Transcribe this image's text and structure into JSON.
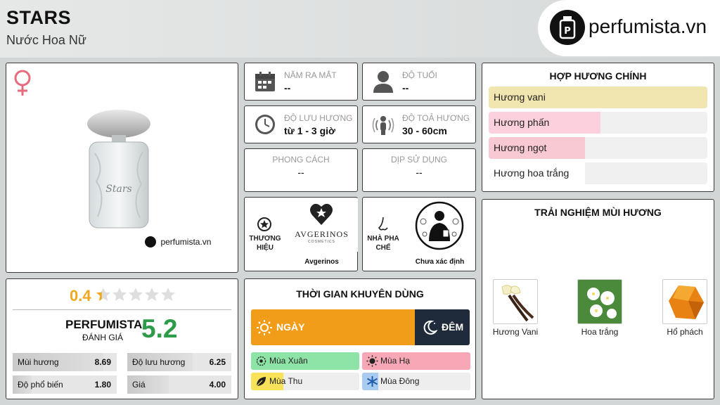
{
  "header": {
    "title": "STARS",
    "subtitle": "Nước Hoa Nữ",
    "logo_text": "perfumista.vn"
  },
  "product": {
    "watermark": "perfumista.vn",
    "bottle_script": "Stars"
  },
  "stats": {
    "release": {
      "label": "NĂM RA MẮT",
      "value": "--"
    },
    "age": {
      "label": "ĐỘ TUỔI",
      "value": "--"
    },
    "longevity": {
      "label": "ĐỘ LƯU HƯƠNG",
      "value": "từ 1 - 3 giờ"
    },
    "sillage": {
      "label": "ĐỘ TOẢ HƯƠNG",
      "value": "30 - 60cm"
    },
    "style": {
      "label": "PHONG CÁCH",
      "value": "--"
    },
    "occasion": {
      "label": "DỊP SỬ DỤNG",
      "value": "--"
    }
  },
  "brand": {
    "label": "THƯƠNG HIỆU",
    "logo_name": "AVGERINOS",
    "logo_sub": "COSMETICS",
    "name": "Avgerinos"
  },
  "perfumer": {
    "label": "NHÀ PHA CHẾ",
    "name": "Chưa xác định"
  },
  "accords": {
    "title": "HỢP HƯƠNG CHÍNH",
    "items": [
      {
        "name": "Hương vani",
        "level": 1.0,
        "color": "#f1e5b0"
      },
      {
        "name": "Hương phấn",
        "level": 0.51,
        "color": "#fcd0dc"
      },
      {
        "name": "Hương ngọt",
        "level": 0.44,
        "color": "#f8c8d3"
      },
      {
        "name": "Hương hoa trắng",
        "level": 0.44,
        "color": "#ffffff"
      }
    ]
  },
  "experience": {
    "title": "TRẢI NGHIỆM MÙI HƯƠNG",
    "notes": [
      {
        "name": "Hương Vani",
        "icon": "vanilla-icon"
      },
      {
        "name": "Hoa trắng",
        "icon": "white-flower-icon"
      },
      {
        "name": "Hổ phách",
        "icon": "amber-icon"
      }
    ]
  },
  "rating": {
    "user_score": "0.4",
    "stars_filled": 0.4,
    "stars_total": 5,
    "brand_label": "PERFUMISTA",
    "sub_label": "ĐÁNH GIÁ",
    "score": "5.2",
    "metrics": [
      {
        "name": "Mùi hương",
        "value": "8.69",
        "level": 0.869
      },
      {
        "name": "Độ lưu hương",
        "value": "6.25",
        "level": 0.625
      },
      {
        "name": "Độ phổ biến",
        "value": "1.80",
        "level": 0.18
      },
      {
        "name": "Giá",
        "value": "4.00",
        "level": 0.4
      }
    ]
  },
  "usage": {
    "title": "THỜI GIAN KHUYÊN DÙNG",
    "day": {
      "label": "NGÀY",
      "level": 0.75
    },
    "night": {
      "label": "ĐÊM",
      "level": 0.25
    },
    "seasons": [
      {
        "name": "Mùa Xuân",
        "level": 1.0,
        "color": "#8ee3a6",
        "icon": "spring-icon"
      },
      {
        "name": "Mùa Hạ",
        "level": 1.0,
        "color": "#f7a7b5",
        "icon": "summer-icon"
      },
      {
        "name": "Mùa Thu",
        "level": 0.3,
        "color": "#f7e25a",
        "icon": "autumn-icon"
      },
      {
        "name": "Mùa Đông",
        "level": 0.15,
        "color": "#a9cbef",
        "icon": "winter-icon"
      }
    ]
  },
  "colors": {
    "accent_orange": "#f19d1a",
    "night_dark": "#1f2a3a",
    "score_green": "#2e9b4a",
    "gender_pink": "#e86a7a"
  }
}
